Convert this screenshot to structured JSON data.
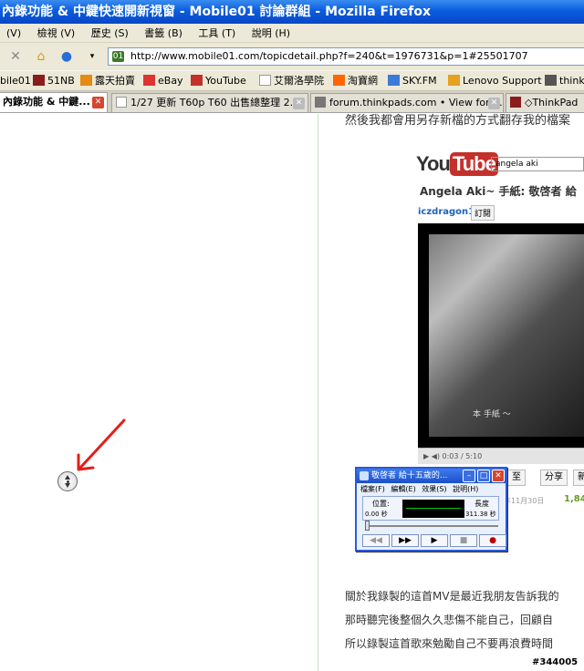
{
  "window": {
    "title": "內錄功能 & 中鍵快速開新視窗 - Mobile01 討論群組 - Mozilla Firefox"
  },
  "menu": [
    "(V)",
    "檢視 (V)",
    "歷史 (S)",
    "書籤 (B)",
    "工具 (T)",
    "說明 (H)"
  ],
  "nav": {
    "url": "http://www.mobile01.com/topicdetail.php?f=240&t=1976731&p=1#25501707"
  },
  "bookmarks": [
    "bile01",
    "51NB",
    "露天拍賣",
    "eBay",
    "YouTube",
    "艾爾洛學院",
    "淘寶網",
    "SKY.FM",
    "Lenovo Support",
    "think"
  ],
  "tabs": [
    {
      "label": "內錄功能 & 中鍵..."
    },
    {
      "label": "1/27 更新 T60p T60 出售總整理 2..."
    },
    {
      "label": "forum.thinkpads.com • View foru..."
    },
    {
      "label": "◇ThinkPad"
    }
  ],
  "article": {
    "cut_line": "然後我都會用另存新檔的方式翻存我的檔案",
    "paragraphs": [
      "關於我錄製的這首MV是最近我朋友告訴我的",
      "那時聽完後整個久久悲傷不能自己，回顧自",
      "所以錄製這首歌來勉勵自己不要再浪費時間"
    ],
    "watermark": "#344005"
  },
  "youtube": {
    "logo_you": "You",
    "logo_tube": "Tube",
    "search": "angela aki",
    "video_title": "Angela Aki~ 手紙: 敬啓者 給",
    "user": "iczdragon1",
    "subscribe": "訂閱",
    "caption": "本 手紙 ～",
    "time": "0:03 / 5:10",
    "btn_like": "至",
    "btn_share": "分享",
    "btn_more": "新",
    "date": "年11月30日",
    "views": "1,84"
  },
  "media_player": {
    "title": "敬啓者 給十五歲的...",
    "menu": [
      "檔案(F)",
      "編輯(E)",
      "效果(S)",
      "說明(H)"
    ],
    "position_label": "位置:",
    "position_value": "0.00 秒",
    "length_label": "長度",
    "length_value": "311.38 秒",
    "buttons": [
      "◀◀",
      "▶▶",
      "▶",
      "■",
      "●"
    ]
  },
  "colors": {
    "titlebar": "#0b5ce0",
    "arrow": "#e0201a",
    "record": "#c00000"
  }
}
